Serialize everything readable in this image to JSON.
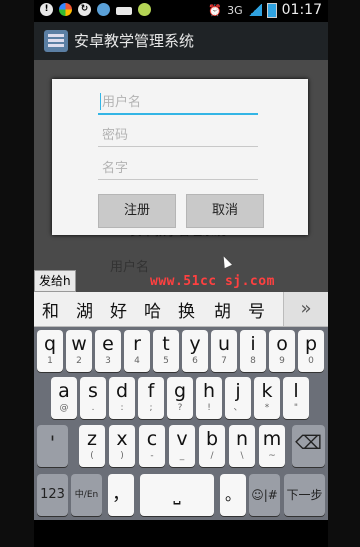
{
  "status_bar": {
    "time": "01:17",
    "network": "3G"
  },
  "action_bar": {
    "title": "安卓教学管理系统"
  },
  "background_form": {
    "title": "安卓教学管理系统",
    "username_placeholder": "用户名"
  },
  "dialog": {
    "username_placeholder": "用户名",
    "password_placeholder": "密码",
    "name_placeholder": "名字",
    "register_label": "注册",
    "cancel_label": "取消"
  },
  "watermark": "www.51cc sj.com",
  "ime": {
    "composing": "发给h",
    "candidates": [
      "和",
      "湖",
      "好",
      "哈",
      "换",
      "胡",
      "号"
    ],
    "more_label": "»",
    "rows": [
      [
        {
          "main": "q",
          "sub": "1"
        },
        {
          "main": "w",
          "sub": "2"
        },
        {
          "main": "e",
          "sub": "3"
        },
        {
          "main": "r",
          "sub": "4"
        },
        {
          "main": "t",
          "sub": "5"
        },
        {
          "main": "y",
          "sub": "6"
        },
        {
          "main": "u",
          "sub": "7"
        },
        {
          "main": "i",
          "sub": "8"
        },
        {
          "main": "o",
          "sub": "9"
        },
        {
          "main": "p",
          "sub": "0"
        }
      ],
      [
        {
          "main": "a",
          "sub": "@"
        },
        {
          "main": "s",
          "sub": "."
        },
        {
          "main": "d",
          "sub": ":"
        },
        {
          "main": "f",
          "sub": ";"
        },
        {
          "main": "g",
          "sub": "?"
        },
        {
          "main": "h",
          "sub": "!"
        },
        {
          "main": "j",
          "sub": "、"
        },
        {
          "main": "k",
          "sub": "*"
        },
        {
          "main": "l",
          "sub": "\""
        }
      ],
      [
        {
          "main": "'",
          "sub": ""
        },
        {
          "main": "z",
          "sub": "("
        },
        {
          "main": "x",
          "sub": ")"
        },
        {
          "main": "c",
          "sub": "-"
        },
        {
          "main": "v",
          "sub": "_"
        },
        {
          "main": "b",
          "sub": "/"
        },
        {
          "main": "n",
          "sub": "\\"
        },
        {
          "main": "m",
          "sub": "~"
        }
      ]
    ],
    "bottom": {
      "num_label": "123",
      "lang_label": "中/En",
      "comma_label": "，",
      "space_label": "⎵",
      "period_label": "。",
      "emoji_label": "☺|#",
      "next_label": "下一步",
      "backspace_icon": "backspace-icon"
    }
  }
}
